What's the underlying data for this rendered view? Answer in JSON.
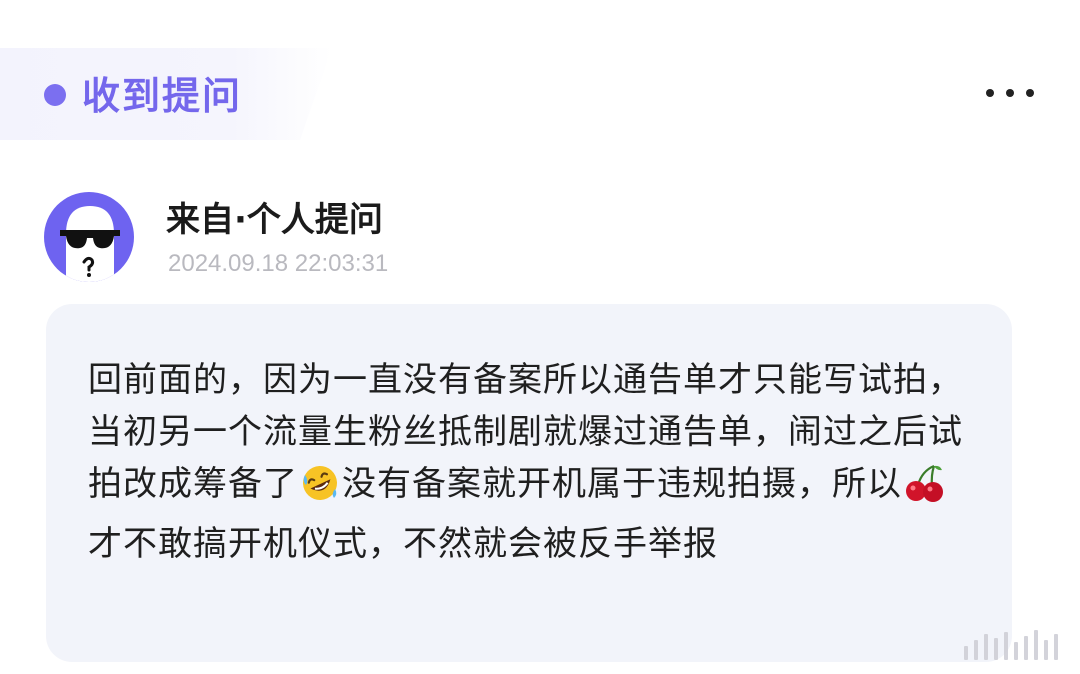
{
  "header": {
    "title": "收到提问",
    "accent_color": "#7467ec",
    "more_icon": "more-horizontal-icon"
  },
  "question": {
    "author": "来自·个人提问",
    "timestamp": "2024.09.18 22:03:31",
    "avatar_icon": "sunglasses-ghost-avatar",
    "body": {
      "part1": "回前面的，因为一直没有备案所以通告单才只能写试拍，当初另一个流量生粉丝抵制剧就爆过通告单，闹过之后试拍改成筹备了",
      "emoji1": "rofl-emoji",
      "part2": "没有备案就开机属于违规拍摄，所以",
      "emoji2": "cherry-emoji",
      "part3": "才不敢搞开机仪式，不然就会被反手举报"
    }
  }
}
